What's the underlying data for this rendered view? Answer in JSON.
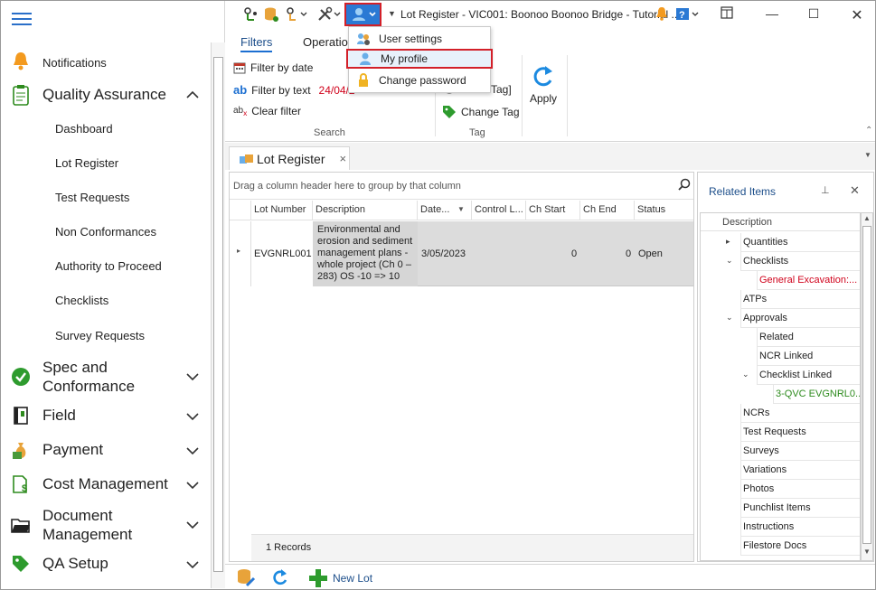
{
  "titlebar": {
    "title": "Lot Register - VIC001: Boonoo Boonoo Bridge - Tutorial ..."
  },
  "sidebar": {
    "items": [
      {
        "label": "Notifications",
        "icon": "bell-icon"
      },
      {
        "label": "Quality Assurance",
        "icon": "clipboard-icon"
      },
      {
        "label": "Spec and Conformance",
        "icon": "check-circle-icon"
      },
      {
        "label": "Field",
        "icon": "book-icon"
      },
      {
        "label": "Payment",
        "icon": "money-bag-icon"
      },
      {
        "label": "Cost Management",
        "icon": "cost-doc-icon"
      },
      {
        "label": "Document Management",
        "icon": "folder-icon"
      },
      {
        "label": "QA Setup",
        "icon": "tag-icon"
      }
    ],
    "qa_subitems": [
      "Dashboard",
      "Lot Register",
      "Test Requests",
      "Non Conformances",
      "Authority to Proceed",
      "Checklists",
      "Survey Requests"
    ]
  },
  "ribbon": {
    "tabs": [
      "Filters",
      "Operatio"
    ],
    "filter_by_date": "Filter by date",
    "filter_by_text": "Filter by text",
    "filter_text_value": "24/04/2",
    "clear_filter": "Clear filter",
    "search_group": "Search",
    "tag_value": "Tag]",
    "change_tag": "Change Tag",
    "tag_group": "Tag",
    "apply": "Apply"
  },
  "menu": {
    "items": [
      "User settings",
      "My profile",
      "Change password"
    ]
  },
  "doc_tab": {
    "label": "Lot Register",
    "close": "×"
  },
  "grid": {
    "group_hint": "Drag a column header here to group by that column",
    "columns": [
      "Lot Number",
      "Description",
      "Date...",
      "Control L...",
      "Ch Start",
      "Ch End",
      "Status"
    ],
    "rows": [
      {
        "lot": "EVGNRL001",
        "description": "Environmental and erosion and sediment management plans - whole project (Ch 0 – 283) OS -10 => 10",
        "date": "3/05/2023",
        "control": "",
        "ch_start": "0",
        "ch_end": "0",
        "status": "Open"
      }
    ],
    "records": "1 Records"
  },
  "related": {
    "title": "Related Items",
    "column": "Description",
    "nodes": [
      {
        "label": "Quantities",
        "chev": "▸",
        "level": 0
      },
      {
        "label": "Checklists",
        "chev": "⌄",
        "level": 0
      },
      {
        "label": "General Excavation:...",
        "chev": "",
        "level": 1,
        "color": "#d0021b"
      },
      {
        "label": "ATPs",
        "chev": "",
        "level": 0
      },
      {
        "label": "Approvals",
        "chev": "⌄",
        "level": 0
      },
      {
        "label": "Related",
        "chev": "",
        "level": 1
      },
      {
        "label": "NCR Linked",
        "chev": "",
        "level": 1
      },
      {
        "label": "Checklist Linked",
        "chev": "⌄",
        "level": 1
      },
      {
        "label": "3-QVC EVGNRL0...",
        "chev": "",
        "level": 2,
        "color": "#2e8b1e"
      },
      {
        "label": "NCRs",
        "chev": "",
        "level": 0
      },
      {
        "label": "Test Requests",
        "chev": "",
        "level": 0
      },
      {
        "label": "Surveys",
        "chev": "",
        "level": 0
      },
      {
        "label": "Variations",
        "chev": "",
        "level": 0
      },
      {
        "label": "Photos",
        "chev": "",
        "level": 0
      },
      {
        "label": "Punchlist Items",
        "chev": "",
        "level": 0
      },
      {
        "label": "Instructions",
        "chev": "",
        "level": 0
      },
      {
        "label": "Filestore Docs",
        "chev": "",
        "level": 0
      }
    ]
  },
  "bottombar": {
    "new_lot": "New Lot"
  },
  "colors": {
    "accent": "#2a79d4",
    "highlight": "#d32029",
    "link": "#1c4e8a"
  }
}
